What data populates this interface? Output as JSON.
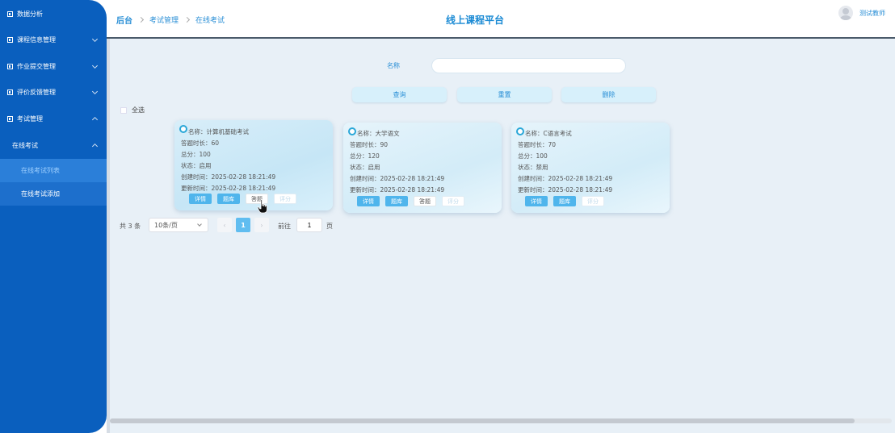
{
  "sidebar": {
    "items": [
      {
        "label": "数据分析",
        "expandable": false
      },
      {
        "label": "课程信息管理",
        "expandable": true
      },
      {
        "label": "作业提交管理",
        "expandable": true
      },
      {
        "label": "评价反馈管理",
        "expandable": true
      },
      {
        "label": "考试管理",
        "expandable": true,
        "expanded": true
      }
    ],
    "submenu_parent": "在线考试",
    "submenu_items": [
      {
        "label": "在线考试列表",
        "active": true
      },
      {
        "label": "在线考试添加",
        "active": false
      }
    ]
  },
  "header": {
    "breadcrumb": [
      "后台",
      "考试管理",
      "在线考试"
    ],
    "title": "线上课程平台",
    "user_name": "测试教师"
  },
  "search": {
    "label": "名称",
    "value": "",
    "placeholder": ""
  },
  "actions": {
    "query": "查询",
    "reset": "重置",
    "delete": "删除"
  },
  "select_all_label": "全选",
  "cards": [
    {
      "name": "名称：计算机基础考试",
      "duration": "答题时长：60",
      "total": "总分：100",
      "status": "状态：启用",
      "created": "创建时间：2025-02-28 18:21:49",
      "updated": "更新时间：2025-02-28 18:21:49",
      "buttons": [
        "详情",
        "题库",
        "答题",
        "评分"
      ]
    },
    {
      "name": "名称：大学语文",
      "duration": "答题时长：90",
      "total": "总分：120",
      "status": "状态：启用",
      "created": "创建时间：2025-02-28 18:21:49",
      "updated": "更新时间：2025-02-28 18:21:49",
      "buttons": [
        "详情",
        "题库",
        "答题",
        "评分"
      ]
    },
    {
      "name": "名称：C语言考试",
      "duration": "答题时长：70",
      "total": "总分：100",
      "status": "状态：禁用",
      "created": "创建时间：2025-02-28 18:21:49",
      "updated": "更新时间：2025-02-28 18:21:49",
      "buttons": [
        "详情",
        "题库",
        "评分"
      ]
    }
  ],
  "pagination": {
    "total": "共 3 条",
    "page_size": "10条/页",
    "prev": "‹",
    "current": "1",
    "next": "›",
    "goto_label": "前往",
    "goto_value": "1",
    "goto_unit": "页"
  },
  "colors": {
    "sidebar": "#0a5fbe",
    "accent": "#2a8fd6",
    "primary_button": "#4fb5ec",
    "page_bg": "#e8f0f7"
  }
}
